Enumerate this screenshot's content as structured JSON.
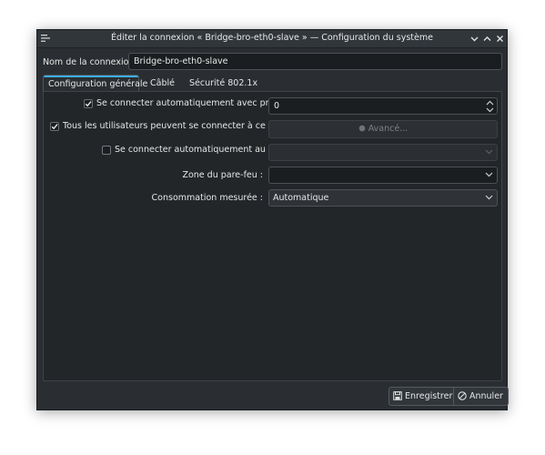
{
  "window": {
    "title": "Éditer la connexion « Bridge-bro-eth0-slave » — Configuration du système"
  },
  "connection": {
    "name_label": "Nom de la connexion :",
    "name_value": "Bridge-bro-eth0-slave"
  },
  "tabs": [
    {
      "label": "Configuration générale",
      "active": true
    },
    {
      "label": "Câblé",
      "active": false
    },
    {
      "label": "Sécurité 802.1x",
      "active": false
    }
  ],
  "general": {
    "auto_connect_priority": {
      "label": "Se connecter automatiquement avec priorité",
      "checked": true,
      "value": "0"
    },
    "all_users": {
      "label": "Tous les utilisateurs peuvent se connecter à ce réseau",
      "checked": true
    },
    "advanced_button": "Avancé...",
    "auto_vpn": {
      "label": "Se connecter automatiquement au VPN",
      "checked": false,
      "value": ""
    },
    "firewall_zone": {
      "label": "Zone du pare-feu :",
      "value": ""
    },
    "metered": {
      "label": "Consommation mesurée :",
      "value": "Automatique"
    }
  },
  "footer": {
    "save_label": "Enregistrer",
    "cancel_label": "Annuler"
  },
  "colors": {
    "accent": "#3daee9",
    "window_bg": "#2a2e32",
    "field_bg": "#1b1e20"
  },
  "icons": {
    "save": "floppy-disk-icon",
    "cancel": "cancel-circle-icon",
    "advanced": "gear-icon"
  }
}
